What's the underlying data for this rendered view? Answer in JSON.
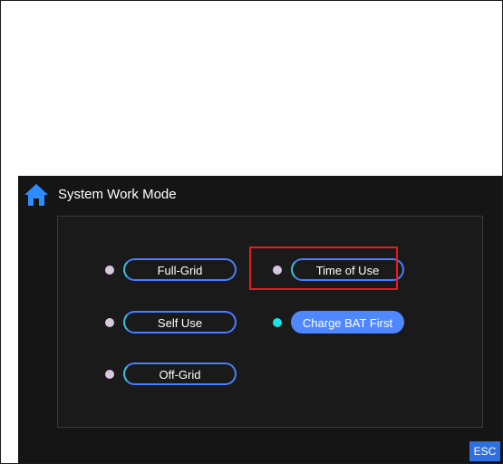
{
  "header": {
    "title": "System Work Mode",
    "home_icon": "home-icon"
  },
  "modes": {
    "full_grid": {
      "label": "Full-Grid",
      "active": false
    },
    "self_use": {
      "label": "Self Use",
      "active": false
    },
    "off_grid": {
      "label": "Off-Grid",
      "active": false
    },
    "time_of_use": {
      "label": "Time of Use",
      "active": false,
      "highlighted": true
    },
    "charge_bat_first": {
      "label": "Charge BAT First",
      "active": true
    }
  },
  "footer": {
    "esc_label": "ESC"
  },
  "colors": {
    "background": "#151515",
    "accent": "#4f87ff",
    "active_dot": "#17e6e6",
    "inactive_dot": "#d9c7dd",
    "highlight_border": "#e51d1d",
    "home_icon": "#2f8cff"
  }
}
